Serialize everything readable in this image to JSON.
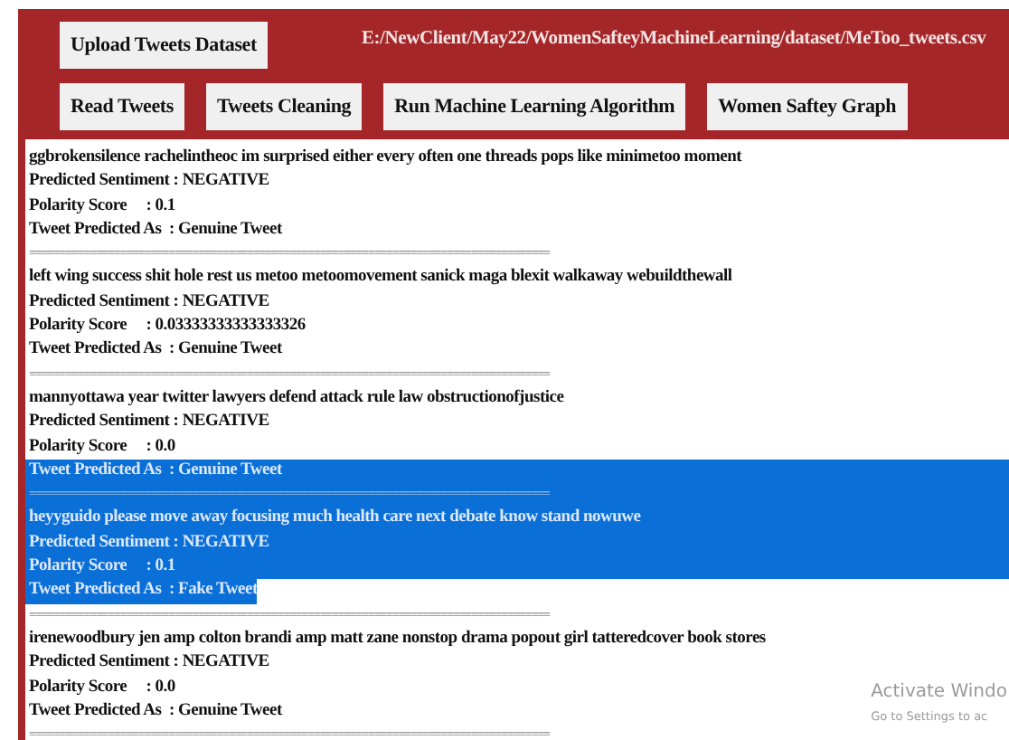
{
  "toolbar": {
    "upload_button": "Upload Tweets Dataset",
    "file_path": "E:/NewClient/May22/WomenSafteyMachineLearning/dataset/MeToo_tweets.csv",
    "buttons": [
      "Read Tweets",
      "Tweets Cleaning",
      "Run Machine Learning Algorithm",
      "Women Saftey Graph"
    ]
  },
  "output_lines": [
    {
      "kind": "text",
      "text": "ggbrokensilence rachelintheoc im surprised either every often one threads pops like minimetoo moment",
      "selected": false
    },
    {
      "kind": "text",
      "text": "Predicted Sentiment : NEGATIVE",
      "selected": false
    },
    {
      "kind": "text",
      "text": "Polarity Score     : 0.1",
      "selected": false
    },
    {
      "kind": "text",
      "text": "Tweet Predicted As  : Genuine Tweet",
      "selected": false
    },
    {
      "kind": "separator",
      "text": "======================================================================================",
      "selected": false
    },
    {
      "kind": "text",
      "text": "left wing success shit hole rest us metoo metoomovement sanick maga blexit walkaway webuildthewall",
      "selected": false
    },
    {
      "kind": "text",
      "text": "Predicted Sentiment : NEGATIVE",
      "selected": false
    },
    {
      "kind": "text",
      "text": "Polarity Score     : 0.03333333333333326",
      "selected": false
    },
    {
      "kind": "text",
      "text": "Tweet Predicted As  : Genuine Tweet",
      "selected": false
    },
    {
      "kind": "separator",
      "text": "======================================================================================",
      "selected": false
    },
    {
      "kind": "text",
      "text": "mannyottawa year twitter lawyers defend attack rule law obstructionofjustice",
      "selected": false
    },
    {
      "kind": "text",
      "text": "Predicted Sentiment : NEGATIVE",
      "selected": false
    },
    {
      "kind": "text",
      "text": "Polarity Score     : 0.0",
      "selected": false
    },
    {
      "kind": "text",
      "text": "Tweet Predicted As  : Genuine Tweet",
      "selected": true
    },
    {
      "kind": "separator",
      "text": "======================================================================================",
      "selected": true
    },
    {
      "kind": "text",
      "text": "heyyguido please move away focusing much health care next debate know stand nowuwe",
      "selected": true
    },
    {
      "kind": "text",
      "text": "Predicted Sentiment : NEGATIVE",
      "selected": true
    },
    {
      "kind": "text",
      "text": "Polarity Score     : 0.1",
      "selected": true
    },
    {
      "kind": "text",
      "text": "Tweet Predicted As  : Fake Tweet",
      "selected": true
    },
    {
      "kind": "separator",
      "text": "======================================================================================",
      "selected": false
    },
    {
      "kind": "text",
      "text": "irenewoodbury jen amp colton brandi amp matt zane nonstop drama popout girl tatteredcover book stores",
      "selected": false
    },
    {
      "kind": "text",
      "text": "Predicted Sentiment : NEGATIVE",
      "selected": false
    },
    {
      "kind": "text",
      "text": "Polarity Score     : 0.0",
      "selected": false
    },
    {
      "kind": "text",
      "text": "Tweet Predicted As  : Genuine Tweet",
      "selected": false
    },
    {
      "kind": "separator",
      "text": "======================================================================================",
      "selected": false
    }
  ],
  "activation_notice": {
    "title": "Activate Windo",
    "subtitle": "Go to Settings to ac"
  }
}
